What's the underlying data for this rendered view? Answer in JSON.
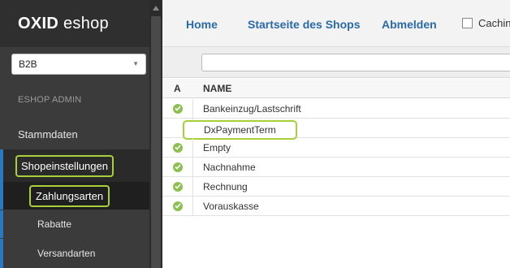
{
  "sidebar": {
    "logo_bold": "OXID",
    "logo_rest": " eshop",
    "shop_select": {
      "value": "B2B"
    },
    "admin_label": "ESHOP ADMIN",
    "nav": {
      "stammdaten": "Stammdaten",
      "shopeinstellungen": "Shopeinstellungen",
      "zahlungsarten": "Zahlungsarten",
      "rabatte": "Rabatte",
      "versandarten": "Versandarten"
    }
  },
  "topnav": {
    "home": "Home",
    "startseite": "Startseite des Shops",
    "abmelden": "Abmelden",
    "caching": "Cachin"
  },
  "list": {
    "columns": {
      "active": "A",
      "name": "NAME"
    },
    "rows": [
      {
        "name": "Bankeinzug/Lastschrift",
        "active": true
      },
      {
        "name": "DxPaymentTerm",
        "active": false
      },
      {
        "name": "Empty",
        "active": true
      },
      {
        "name": "Nachnahme",
        "active": true
      },
      {
        "name": "Rechnung",
        "active": true
      },
      {
        "name": "Vorauskasse",
        "active": true
      }
    ]
  },
  "colors": {
    "accent_blue": "#2a6aa8",
    "highlight_green": "#a8cf3a",
    "active_green": "#8cc152",
    "sidebar_bg": "#3b3b3b"
  }
}
